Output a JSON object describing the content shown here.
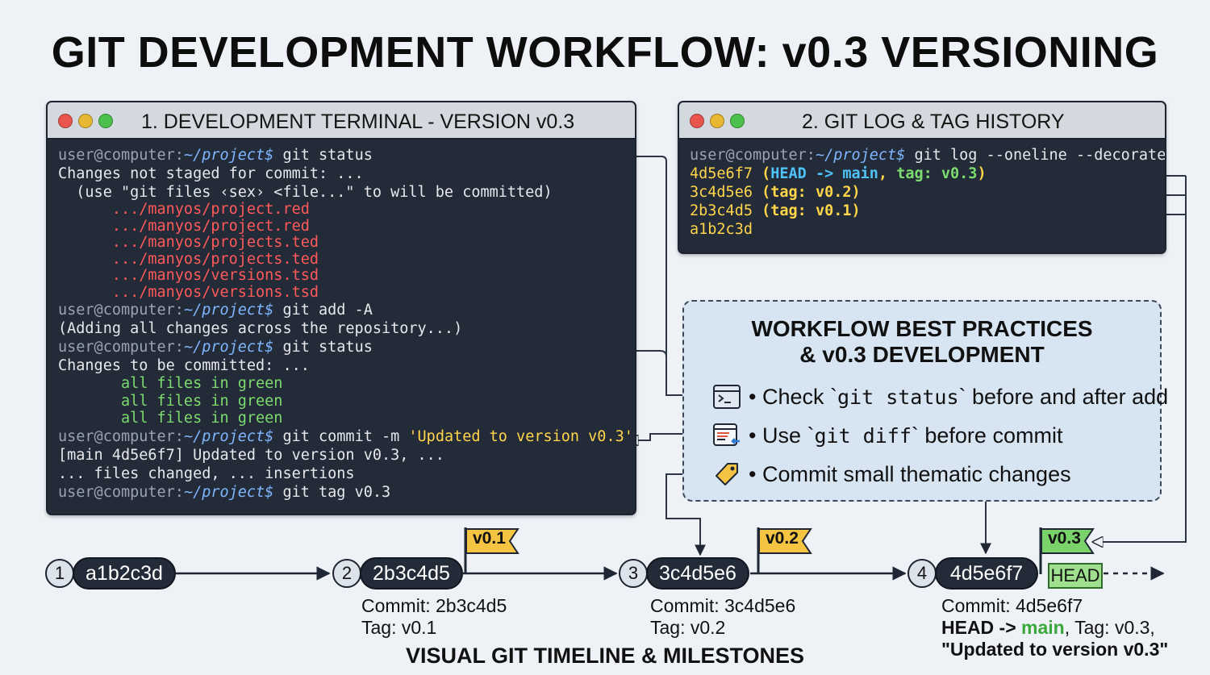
{
  "title": "GIT DEVELOPMENT WORKFLOW: v0.3 VERSIONING",
  "terminal": {
    "title": "1. DEVELOPMENT TERMINAL - VERSION v0.3",
    "prompt_user": "user@computer:",
    "prompt_path": "~/project$",
    "cmd_status": " git status",
    "not_staged": "Changes not staged for commit: ...",
    "use_hint": "  (use \"git files ‹sex› <file...\" to will be committed)",
    "red_files": [
      "      .../manyos/project.red",
      "      .../manyos/project.red",
      "      .../manyos/projects.ted",
      "      .../manyos/projects.ted",
      "      .../manyos/versions.tsd",
      "      .../manyos/versions.tsd"
    ],
    "cmd_add": " git add -A",
    "adding": "(Adding all changes across the repository...)",
    "cmd_status2": " git status",
    "to_commit": "Changes to be committed: ...",
    "green_files": [
      "       all files in green",
      "       all files in green",
      "       all files in green"
    ],
    "cmd_commit": " git commit -m ",
    "commit_msg": "'Updated to version v0.3'",
    "commit_result": "[main 4d5e6f7] Updated to version v0.3, ...",
    "files_changed": "... files changed, ... insertions",
    "cmd_tag": " git tag v0.3"
  },
  "gitlog": {
    "title": "2. GIT LOG & TAG HISTORY",
    "prompt_user": "user@computer:",
    "prompt_path": "~/project$",
    "cmd": " git log --oneline --decorate",
    "lines": [
      {
        "hash": "4d5e6f7",
        "open": " (",
        "head": "HEAD -> main",
        "sep": ", ",
        "tag": "tag: v0.3",
        "close": ")"
      },
      {
        "hash": "3c4d5e6",
        "open": " (",
        "tag": "tag: v0.2",
        "close": ")"
      },
      {
        "hash": "2b3c4d5",
        "open": " (",
        "tag": "tag: v0.1",
        "close": ")"
      },
      {
        "hash": "a1b2c3d"
      }
    ]
  },
  "best_practices": {
    "title_line1": "WORKFLOW BEST PRACTICES",
    "title_line2": "& v0.3 DEVELOPMENT",
    "items": [
      {
        "pre": "• Check `",
        "code": "git status",
        "post": "` before and after add",
        "icon": "terminal-icon"
      },
      {
        "pre": "• Use `",
        "code": "git diff",
        "post": "` before commit",
        "icon": "diff-window-icon"
      },
      {
        "pre": "• Commit small thematic changes",
        "code": "",
        "post": "",
        "icon": "tag-icon"
      }
    ]
  },
  "timeline": {
    "title": "VISUAL GIT TIMELINE & MILESTONES",
    "nodes": [
      {
        "num": "1",
        "hash": "a1b2c3d"
      },
      {
        "num": "2",
        "hash": "2b3c4d5"
      },
      {
        "num": "3",
        "hash": "3c4d5e6"
      },
      {
        "num": "4",
        "hash": "4d5e6f7"
      }
    ],
    "flags": [
      "v0.1",
      "v0.2",
      "v0.3"
    ],
    "head_label": "HEAD",
    "captions": [
      {
        "commit": "Commit: 2b3c4d5",
        "tag": "Tag: v0.1"
      },
      {
        "commit": "Commit: 3c4d5e6",
        "tag": "Tag: v0.2"
      },
      {
        "commit": "Commit: 4d5e6f7",
        "head": "HEAD ->",
        "main": "main",
        "tag": ", Tag: v0.3,",
        "msg": "\"Updated to version v0.3\""
      }
    ]
  },
  "colors": {
    "flag_yellow": "#f6c443",
    "flag_green": "#7ad36a",
    "terminal_bg": "#232a38",
    "connector": "#3d4757"
  }
}
